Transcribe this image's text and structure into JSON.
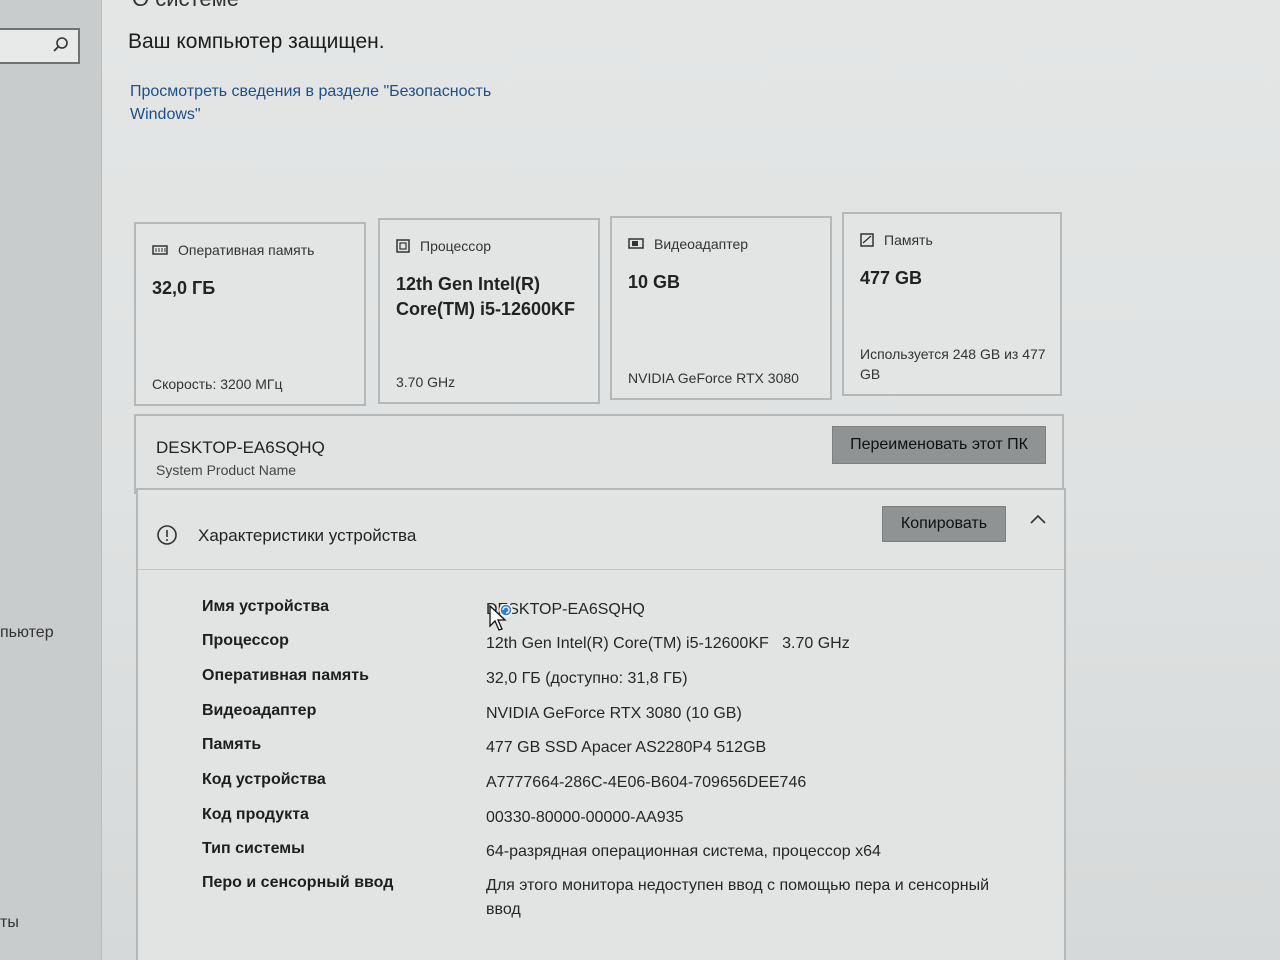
{
  "sidebar": {
    "items": [
      {
        "label": "пьютер"
      },
      {
        "label": "ты"
      }
    ]
  },
  "header": {
    "top_cut_text": "О системе",
    "protected_text": "Ваш компьютер защищен.",
    "security_link": "Просмотреть сведения в разделе \"Безопасность Windows\""
  },
  "cards": [
    {
      "title": "Оперативная память",
      "value": "32,0 ГБ",
      "sub": "Скорость: 3200 МГц",
      "icon": "ram-icon"
    },
    {
      "title": "Процессор",
      "value": "12th Gen Intel(R) Core(TM) i5-12600KF",
      "sub": "3.70 GHz",
      "icon": "cpu-icon"
    },
    {
      "title": "Видеоадаптер",
      "value": "10 GB",
      "sub": "NVIDIA GeForce RTX 3080",
      "icon": "gpu-icon"
    },
    {
      "title": "Память",
      "value": "477 GB",
      "sub": "Используется 248 GB из 477 GB",
      "icon": "storage-icon"
    }
  ],
  "pc": {
    "name": "DESKTOP-EA6SQHQ",
    "model": "System Product Name",
    "rename_label": "Переименовать этот ПК"
  },
  "specs": {
    "title": "Характеристики устройства",
    "copy_label": "Копировать",
    "rows": [
      {
        "label": "Имя устройства",
        "value": "DESKTOP-EA6SQHQ"
      },
      {
        "label": "Процессор",
        "value": "12th Gen Intel(R) Core(TM) i5-12600KF   3.70 GHz"
      },
      {
        "label": "Оперативная память",
        "value": "32,0 ГБ (доступно: 31,8 ГБ)"
      },
      {
        "label": "Видеоадаптер",
        "value": "NVIDIA GeForce RTX 3080 (10 GB)"
      },
      {
        "label": "Память",
        "value": "477 GB SSD Apacer AS2280P4 512GB"
      },
      {
        "label": "Код устройства",
        "value": "A7777664-286C-4E06-B604-709656DEE746"
      },
      {
        "label": "Код продукта",
        "value": "00330-80000-00000-AA935"
      },
      {
        "label": "Тип системы",
        "value": "64-разрядная операционная система, процессор x64"
      },
      {
        "label": "Перо и сенсорный ввод",
        "value": "Для этого монитора недоступен ввод с помощью пера и сенсорный ввод"
      }
    ]
  },
  "colors": {
    "link": "#1d4f87",
    "button": "#8f9394",
    "cursor_badge": "#2f7fd8"
  }
}
